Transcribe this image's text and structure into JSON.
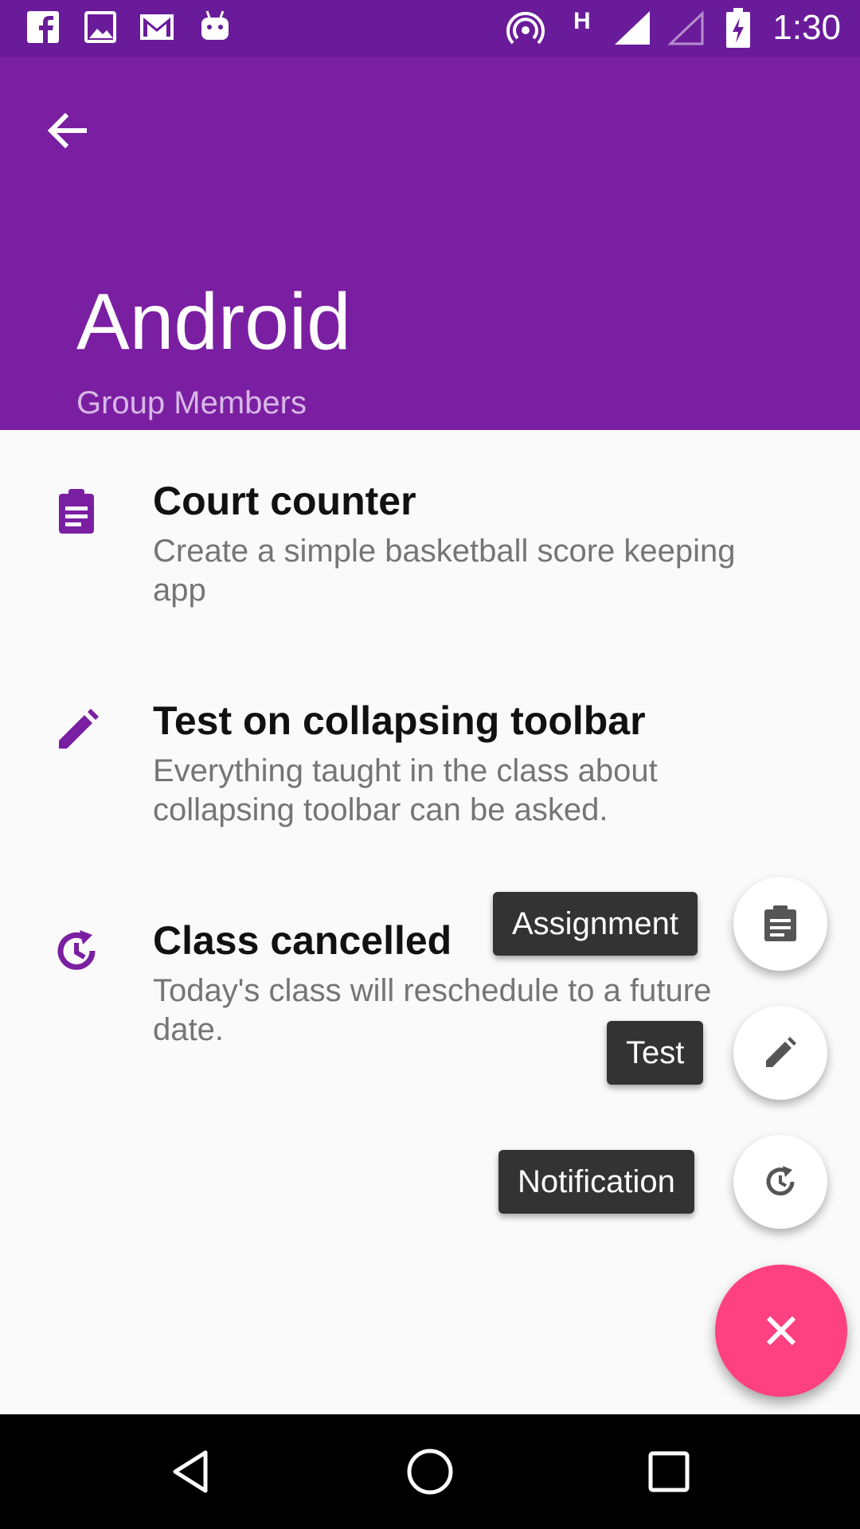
{
  "status_bar": {
    "time": "1:30",
    "left_icons": [
      "facebook-icon",
      "gallery-icon",
      "gmail-icon",
      "android-icon"
    ],
    "right_icons": [
      "hotspot-icon",
      "network-h-icon",
      "signal-full-icon",
      "signal-empty-icon",
      "battery-charging-icon"
    ]
  },
  "app_bar": {
    "title": "Android",
    "subtitle": "Group Members",
    "color": "#7b1fa2"
  },
  "items": [
    {
      "icon": "clipboard-icon",
      "title": "Court counter",
      "description": "Create a simple basketball score keeping app"
    },
    {
      "icon": "pencil-icon",
      "title": "Test on collapsing toolbar",
      "description": "Everything taught in the class about collapsing toolbar can be asked."
    },
    {
      "icon": "restore-icon",
      "title": "Class cancelled",
      "description": "Today's class will reschedule to a future date."
    }
  ],
  "fab_menu": {
    "assignment_label": "Assignment",
    "test_label": "Test",
    "notification_label": "Notification",
    "close_icon": "close-icon",
    "accent": "#ff4081"
  },
  "nav_bar": {
    "icons": [
      "back-triangle-icon",
      "home-circle-icon",
      "recents-square-icon"
    ]
  }
}
